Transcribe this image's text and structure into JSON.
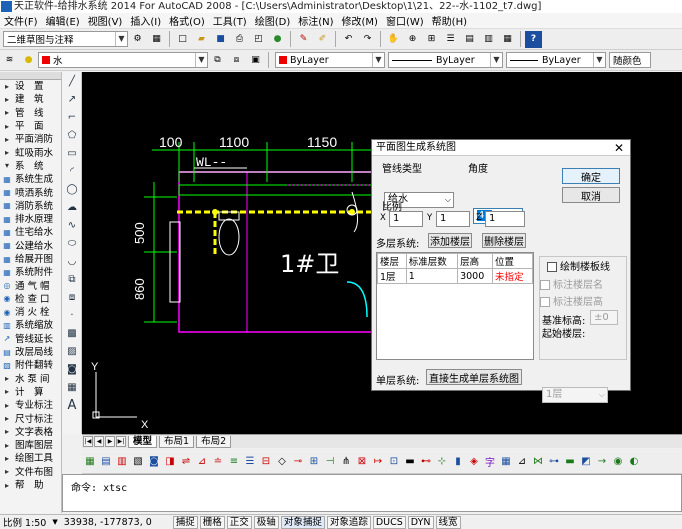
{
  "window": {
    "title": "天正软件-给排水系统 2014 For AutoCAD 2008 - [C:\\Users\\Administrator\\Desktop\\1\\21、22--水-1102_t7.dwg]"
  },
  "menu": [
    "文件(F)",
    "编辑(E)",
    "视图(V)",
    "插入(I)",
    "格式(O)",
    "工具(T)",
    "绘图(D)",
    "标注(N)",
    "修改(M)",
    "窗口(W)",
    "帮助(H)"
  ],
  "toolbar1": {
    "workspace": "二维草图与注释"
  },
  "toolbar2": {
    "layer": "水",
    "color": "ByLayer",
    "linetype": "ByLayer",
    "lineweight": "ByLayer",
    "plotstyle": "随颜色"
  },
  "left_panel": {
    "items": [
      "设　置",
      "建　筑",
      "管　线",
      "平　面",
      "平面消防",
      "虹吸雨水",
      "系　统",
      "系统生成",
      "喷洒系统",
      "消防系统",
      "排水原理",
      "住宅给水",
      "公建给水",
      "给展开图",
      "系统附件",
      "通 气 帽",
      "检 查 口",
      "消 火 栓",
      "系统缩放",
      "管线延长",
      "改层局线",
      "附件翻转",
      "水 泵 间",
      "计　算",
      "专业标注",
      "尺寸标注",
      "文字表格",
      "图库图层",
      "绘图工具",
      "文件布图",
      "帮　助"
    ],
    "colors": {
      "accent": "#1c63b7"
    }
  },
  "drawing": {
    "dims": [
      "100",
      "1100",
      "1150"
    ],
    "vdims": [
      "500",
      "860"
    ],
    "pipe_label": "WL--",
    "room_label": "1#卫",
    "axis_y": "Y",
    "axis_x": "X",
    "colors": {
      "bg": "#000000",
      "pipe": "#ffff00",
      "dim": "#00ff00",
      "wall": "#ff00ff"
    }
  },
  "tabs": [
    "模型",
    "布局1",
    "布局2"
  ],
  "command": {
    "prompt": "命令:",
    "text": "xtsc"
  },
  "status": {
    "scale": "比例 1:50",
    "coords": "33938, -177873, 0",
    "toggles": [
      "捕捉",
      "栅格",
      "正交",
      "极轴",
      "对象捕捉",
      "对象追踪",
      "DUCS",
      "DYN",
      "线宽"
    ]
  },
  "dialog": {
    "title": "平面图生成系统图",
    "close": "✕",
    "pipe_type_label": "管线类型",
    "pipe_type_value": "给水",
    "angle_label": "角度",
    "angle_value": "45",
    "ok": "确定",
    "cancel": "取消",
    "scale_label": "比例",
    "scale": {
      "x_label": "X",
      "x": "1",
      "y_label": "Y",
      "y": "1",
      "z_label": "Z",
      "z": "1"
    },
    "multi_label": "多层系统:",
    "add_floor": "添加楼层",
    "del_floor": "删除楼层",
    "table": {
      "headers": [
        "楼层",
        "标准层数",
        "层高",
        "位置"
      ],
      "rows": [
        [
          "1层",
          "1",
          "3000",
          "未指定"
        ]
      ]
    },
    "draw_floor_line": "绘制楼板线",
    "mark_floor_name": "标注楼层名",
    "mark_floor_height": "标注楼层高",
    "base_elev_label": "基准标高:",
    "base_elev_value": "±0",
    "start_floor_label": "起始楼层:",
    "start_floor_value": "1层",
    "single_label": "单层系统:",
    "single_button": "直接生成单层系统图",
    "colors": {
      "unset": "#ff0000"
    }
  }
}
